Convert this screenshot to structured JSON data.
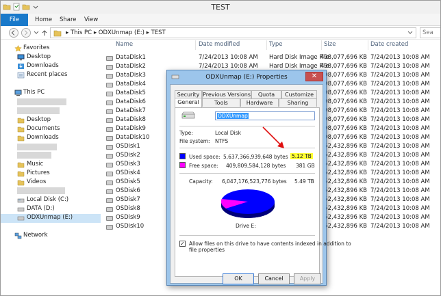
{
  "window": {
    "title": "TEST"
  },
  "ribbon": {
    "tabs": [
      "File",
      "Home",
      "Share",
      "View"
    ]
  },
  "address": {
    "crumbs": [
      "This PC",
      "ODXUnmap (E:)",
      "TEST"
    ],
    "search_label": "Sea"
  },
  "nav": {
    "favorites_label": "Favorites",
    "favorites": [
      "Desktop",
      "Downloads",
      "Recent places"
    ],
    "thispc_label": "This PC",
    "thispc": [
      "Desktop",
      "Documents",
      "Downloads",
      "Music",
      "Pictures",
      "Videos",
      "Local Disk (C:)",
      "DATA (D:)",
      "ODXUnmap (E:)"
    ],
    "network_label": "Network"
  },
  "columns": {
    "name": "Name",
    "date": "Date modified",
    "type": "Type",
    "size": "Size",
    "created": "Date created"
  },
  "files": [
    {
      "name": "DataDisk1",
      "date": "7/24/2013 10:08 AM",
      "type": "Hard Disk Image File",
      "size": "498,077,696 KB",
      "created": "7/24/2013 10:08 AM"
    },
    {
      "name": "DataDisk2",
      "date": "7/24/2013 10:08 AM",
      "type": "Hard Disk Image File",
      "size": "498,077,696 KB",
      "created": "7/24/2013 10:08 AM"
    },
    {
      "name": "DataDisk3",
      "date": "",
      "type": "",
      "size": "498,077,696 KB",
      "created": "7/24/2013 10:08 AM"
    },
    {
      "name": "DataDisk4",
      "date": "",
      "type": "",
      "size": "498,077,696 KB",
      "created": "7/24/2013 10:08 AM"
    },
    {
      "name": "DataDisk5",
      "date": "",
      "type": "",
      "size": "498,077,696 KB",
      "created": "7/24/2013 10:08 AM"
    },
    {
      "name": "DataDisk6",
      "date": "",
      "type": "",
      "size": "498,077,696 KB",
      "created": "7/24/2013 10:08 AM"
    },
    {
      "name": "DataDisk7",
      "date": "",
      "type": "",
      "size": "498,077,696 KB",
      "created": "7/24/2013 10:08 AM"
    },
    {
      "name": "DataDisk8",
      "date": "",
      "type": "",
      "size": "498,077,696 KB",
      "created": "7/24/2013 10:08 AM"
    },
    {
      "name": "DataDisk9",
      "date": "",
      "type": "",
      "size": "498,077,696 KB",
      "created": "7/24/2013 10:08 AM"
    },
    {
      "name": "DataDisk10",
      "date": "",
      "type": "",
      "size": "498,077,696 KB",
      "created": "7/24/2013 10:08 AM"
    },
    {
      "name": "OSDisk1",
      "date": "",
      "type": "",
      "size": "52,432,896 KB",
      "created": "7/24/2013 10:08 AM"
    },
    {
      "name": "OSDisk2",
      "date": "",
      "type": "",
      "size": "52,432,896 KB",
      "created": "7/24/2013 10:08 AM"
    },
    {
      "name": "OSDisk3",
      "date": "",
      "type": "",
      "size": "52,432,896 KB",
      "created": "7/24/2013 10:08 AM"
    },
    {
      "name": "OSDisk4",
      "date": "",
      "type": "",
      "size": "52,432,896 KB",
      "created": "7/24/2013 10:08 AM"
    },
    {
      "name": "OSDisk5",
      "date": "",
      "type": "",
      "size": "52,432,896 KB",
      "created": "7/24/2013 10:08 AM"
    },
    {
      "name": "OSDisk6",
      "date": "",
      "type": "",
      "size": "52,432,896 KB",
      "created": "7/24/2013 10:08 AM"
    },
    {
      "name": "OSDisk7",
      "date": "",
      "type": "",
      "size": "52,432,896 KB",
      "created": "7/24/2013 10:08 AM"
    },
    {
      "name": "OSDisk8",
      "date": "",
      "type": "",
      "size": "52,432,896 KB",
      "created": "7/24/2013 10:08 AM"
    },
    {
      "name": "OSDisk9",
      "date": "",
      "type": "",
      "size": "52,432,896 KB",
      "created": "7/24/2013 10:08 AM"
    },
    {
      "name": "OSDisk10",
      "date": "",
      "type": "",
      "size": "52,432,896 KB",
      "created": "7/24/2013 10:08 AM"
    }
  ],
  "dialog": {
    "title": "ODXUnmap (E:) Properties",
    "close_label": "✕",
    "tabs_row1": [
      "Security",
      "Previous Versions",
      "Quota",
      "Customize"
    ],
    "tabs_row2": [
      "General",
      "Tools",
      "Hardware",
      "Sharing"
    ],
    "name_value": "ODXUnmap",
    "type_label": "Type:",
    "type_value": "Local Disk",
    "fs_label": "File system:",
    "fs_value": "NTFS",
    "used_label": "Used space:",
    "used_bytes": "5,637,366,939,648 bytes",
    "used_h": "5.12 TB",
    "free_label": "Free space:",
    "free_bytes": "409,809,584,128 bytes",
    "free_h": "381 GB",
    "cap_label": "Capacity:",
    "cap_bytes": "6,047,176,523,776 bytes",
    "cap_h": "5.49 TB",
    "drive_label": "Drive E:",
    "index_label": "Allow files on this drive to have contents indexed in addition to file properties",
    "index_label_l1": "Allow files on this drive to have contents indexed in addition to",
    "index_label_l2": "file properties",
    "index_checked": true,
    "ok_label": "OK",
    "cancel_label": "Cancel",
    "apply_label": "Apply"
  },
  "colors": {
    "used": "#0000ff",
    "free": "#ff00ff",
    "highlight": "#ffff33",
    "arrow": "#e01010",
    "file_tab": "#1979ca"
  }
}
